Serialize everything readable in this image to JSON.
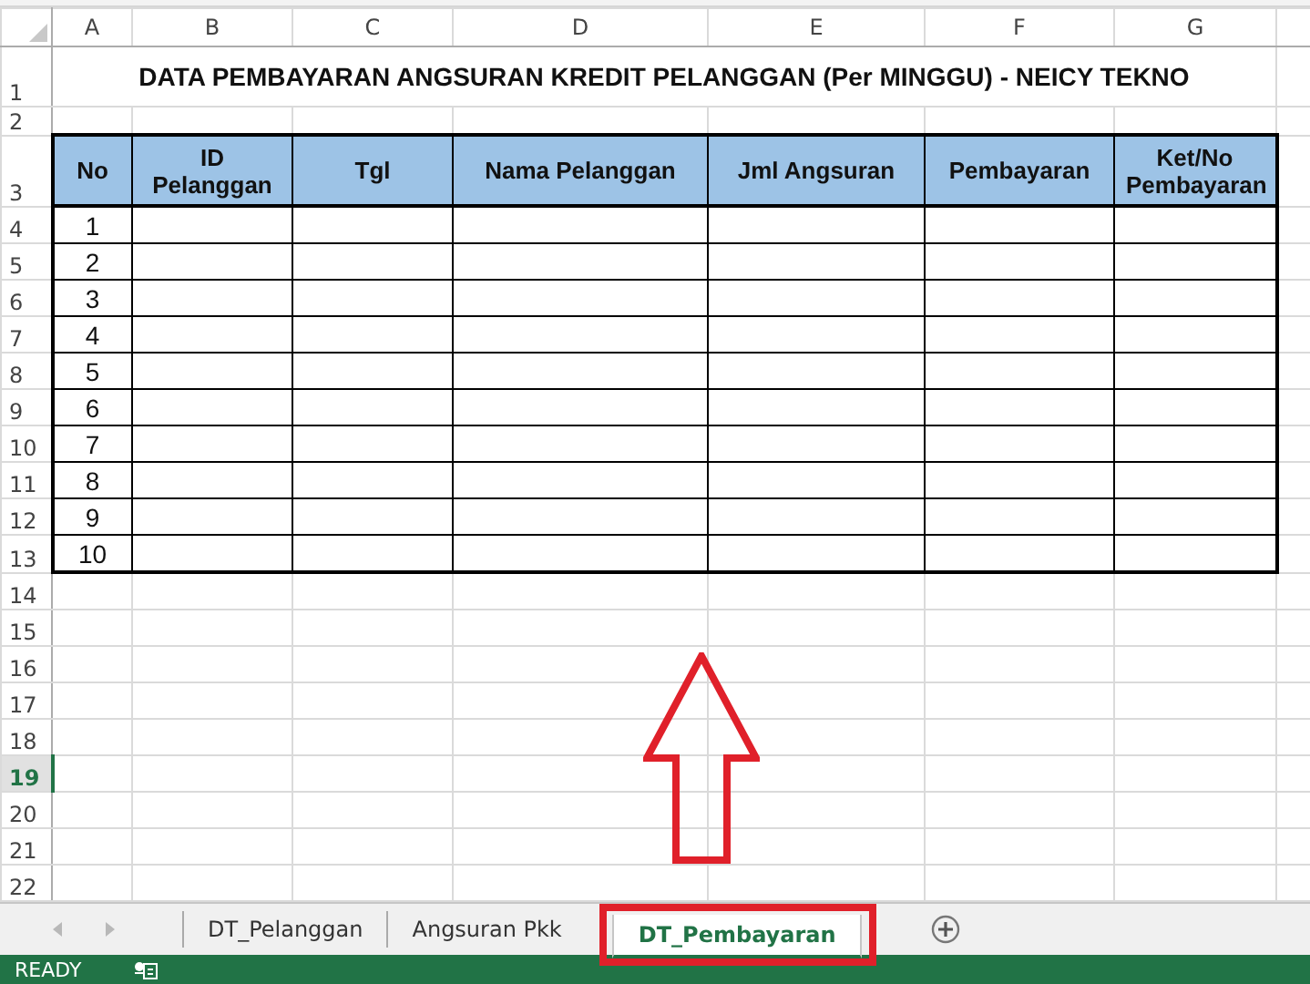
{
  "column_headers": [
    {
      "label": "A",
      "selected": false
    },
    {
      "label": "B",
      "selected": false
    },
    {
      "label": "C",
      "selected": false
    },
    {
      "label": "D",
      "selected": false
    },
    {
      "label": "E",
      "selected": false
    },
    {
      "label": "F",
      "selected": false
    },
    {
      "label": "G",
      "selected": false
    }
  ],
  "row_headers": [
    {
      "label": "1",
      "selected": false
    },
    {
      "label": "2",
      "selected": false
    },
    {
      "label": "3",
      "selected": false
    },
    {
      "label": "4",
      "selected": false
    },
    {
      "label": "5",
      "selected": false
    },
    {
      "label": "6",
      "selected": false
    },
    {
      "label": "7",
      "selected": false
    },
    {
      "label": "8",
      "selected": false
    },
    {
      "label": "9",
      "selected": false
    },
    {
      "label": "10",
      "selected": false
    },
    {
      "label": "11",
      "selected": false
    },
    {
      "label": "12",
      "selected": false
    },
    {
      "label": "13",
      "selected": false
    },
    {
      "label": "14",
      "selected": false
    },
    {
      "label": "15",
      "selected": false
    },
    {
      "label": "16",
      "selected": false
    },
    {
      "label": "17",
      "selected": false
    },
    {
      "label": "18",
      "selected": false
    },
    {
      "label": "19",
      "selected": true
    },
    {
      "label": "20",
      "selected": false
    },
    {
      "label": "21",
      "selected": false
    },
    {
      "label": "22",
      "selected": false
    }
  ],
  "title": "DATA PEMBAYARAN ANGSURAN KREDIT PELANGGAN (Per MINGGU) - NEICY TEKNO",
  "table": {
    "columns": [
      "No",
      "ID Pelanggan",
      "Tgl",
      "Nama Pelanggan",
      "Jml Angsuran",
      "Pembayaran",
      "Ket/No Pembayaran"
    ],
    "rows": [
      [
        "1"
      ],
      [
        "2"
      ],
      [
        "3"
      ],
      [
        "4"
      ],
      [
        "5"
      ],
      [
        "6"
      ],
      [
        "7"
      ],
      [
        "8"
      ],
      [
        "9"
      ],
      [
        "10"
      ]
    ]
  },
  "sheet_tabs": [
    {
      "label": "DT_Pelanggan",
      "selected": false
    },
    {
      "label": "Angsuran Pkk",
      "selected": false
    },
    {
      "label": "DT_Pembayaran",
      "selected": true
    }
  ],
  "status_bar": {
    "mode": "READY"
  }
}
